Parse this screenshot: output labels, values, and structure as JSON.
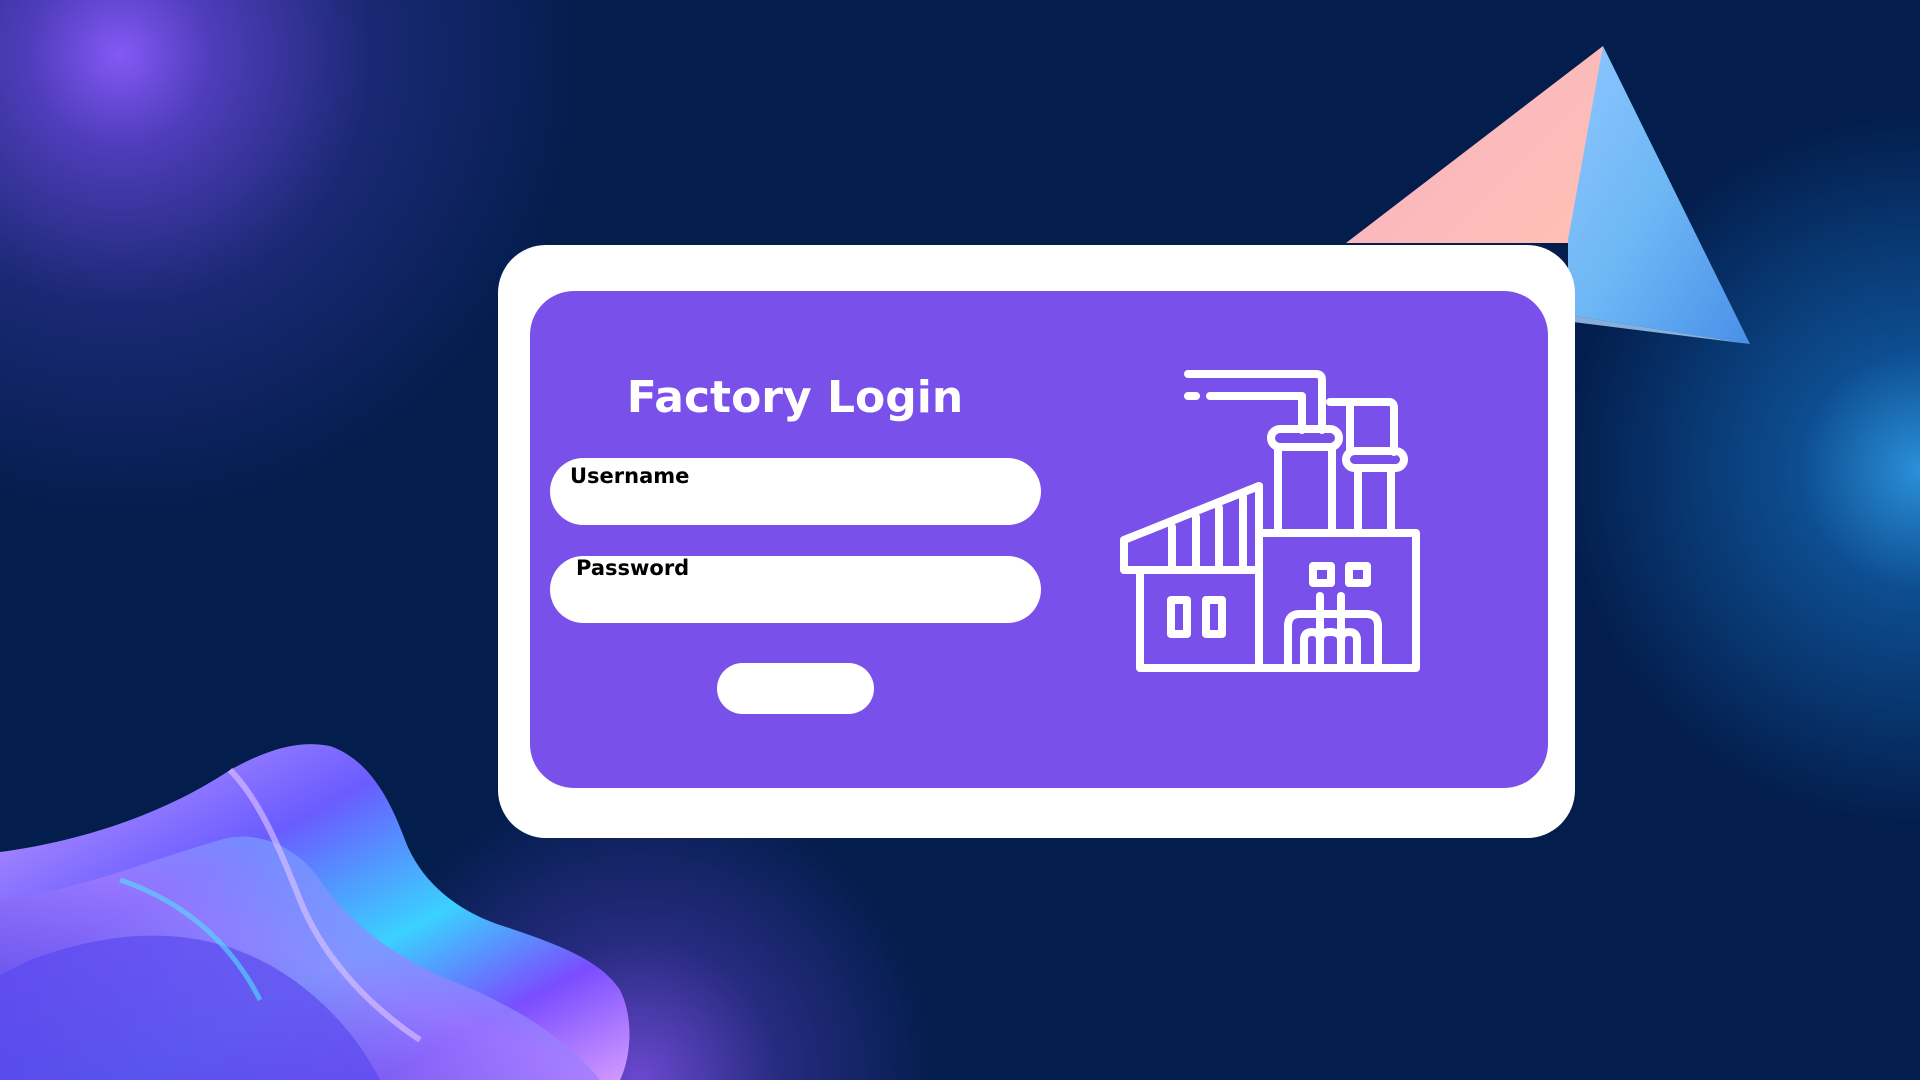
{
  "login": {
    "title": "Factory Login",
    "username_label": "Username",
    "password_label": "Password",
    "submit_label": ""
  },
  "icons": {
    "illustration": "factory-icon"
  },
  "colors": {
    "background": "#031d4c",
    "card_border": "#ffffff",
    "card_panel": "#7a50eb",
    "text_primary": "#ffffff",
    "label_text": "#000000"
  }
}
